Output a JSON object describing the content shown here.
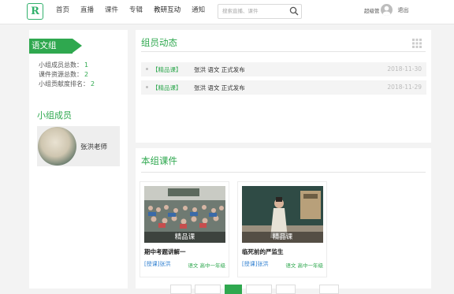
{
  "header": {
    "logo": "R",
    "nav": [
      "首页",
      "直播",
      "课件",
      "专辑",
      "教研互动",
      "通知"
    ],
    "search_placeholder": "搜索直播、课件",
    "username": "超级管",
    "logout": "退出"
  },
  "group": {
    "name": "语文组",
    "stats": [
      {
        "label": "小组成员总数：",
        "value": "1"
      },
      {
        "label": "课件资源总数：",
        "value": "2"
      },
      {
        "label": "小组贡献度排名：",
        "value": "2"
      }
    ],
    "members_title": "小组成员",
    "members": [
      {
        "name": "张洪老师"
      }
    ]
  },
  "activity": {
    "title": "组员动态",
    "items": [
      {
        "tag": "【精品课】",
        "text": "张洪 语文 正式发布",
        "date": "2018-11-30"
      },
      {
        "tag": "【精品课】",
        "text": "张洪 语文 正式发布",
        "date": "2018-11-29"
      }
    ]
  },
  "courses": {
    "title": "本组课件",
    "items": [
      {
        "badge": "精品课",
        "title": "期中考题讲解一",
        "author": "[授课]张洪",
        "grade": "语文 高中一年级"
      },
      {
        "badge": "精品课",
        "title": "临死前的严监生",
        "author": "[授课]张洪",
        "grade": "语文 高中一年级"
      }
    ]
  },
  "colors": {
    "accent": "#2fa84f",
    "link": "#2f7fd0"
  }
}
